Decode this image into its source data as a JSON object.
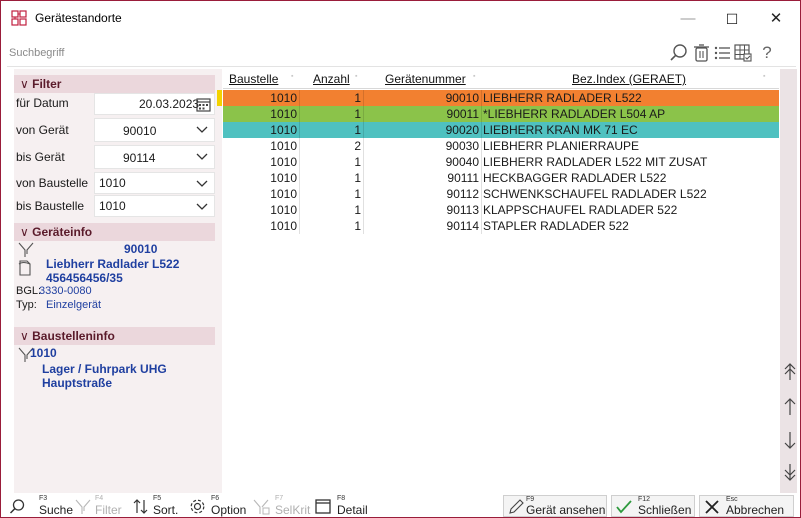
{
  "window": {
    "title": "Gerätestandorte",
    "controls": {
      "minimize": "—",
      "maximize": "☐",
      "close": "✕"
    }
  },
  "search": {
    "placeholder": "Suchbegriff",
    "icons": [
      "search-icon",
      "trash-icon",
      "list-icon",
      "grid-select-icon",
      "help-icon"
    ],
    "help_label": "?"
  },
  "filter": {
    "header": "Filter",
    "rows": [
      {
        "label": "für Datum",
        "value": "20.03.2023"
      },
      {
        "label": "von Gerät",
        "value": "90010"
      },
      {
        "label": "bis Gerät",
        "value": "90114"
      },
      {
        "label": "von Baustelle",
        "value": "1010"
      },
      {
        "label": "bis Baustelle",
        "value": "1010"
      }
    ]
  },
  "geraeteinfo": {
    "header": "Geräteinfo",
    "number": "90010",
    "name": "Liebherr Radlader L522",
    "serial": "456456456/35",
    "bgl_label": "BGL:",
    "bgl_value": "3330-0080",
    "typ_label": "Typ:",
    "typ_value": "Einzelgerät"
  },
  "baustelleninfo": {
    "header": "Baustelleninfo",
    "number": "1010",
    "name": "Lager / Fuhrpark UHG",
    "street": "Hauptstraße"
  },
  "grid": {
    "columns": [
      "Baustelle",
      "Anzahl",
      "Gerätenummer",
      "Bez.Index (GERAET)"
    ],
    "rows": [
      {
        "baustelle": "1010",
        "anzahl": "1",
        "nummer": "90010",
        "bez": "LIEBHERR RADLADER L522",
        "bg": "#f28030",
        "marker": true
      },
      {
        "baustelle": "1010",
        "anzahl": "1",
        "nummer": "90011",
        "bez": "*LIEBHERR RADLADER L504 AP",
        "bg": "#8bc34a",
        "marker": false
      },
      {
        "baustelle": "1010",
        "anzahl": "1",
        "nummer": "90020",
        "bez": "LIEBHERR KRAN MK 71 EC",
        "bg": "#4fc1c0",
        "marker": false
      },
      {
        "baustelle": "1010",
        "anzahl": "2",
        "nummer": "90030",
        "bez": "LIEBHERR PLANIERRAUPE",
        "bg": "",
        "marker": false
      },
      {
        "baustelle": "1010",
        "anzahl": "1",
        "nummer": "90040",
        "bez": "LIEBHERR RADLADER L522 MIT ZUSAT",
        "bg": "",
        "marker": false
      },
      {
        "baustelle": "1010",
        "anzahl": "1",
        "nummer": "90111",
        "bez": "HECKBAGGER RADLADER L522",
        "bg": "",
        "marker": false
      },
      {
        "baustelle": "1010",
        "anzahl": "1",
        "nummer": "90112",
        "bez": "SCHWENKSCHAUFEL RADLADER L522",
        "bg": "",
        "marker": false
      },
      {
        "baustelle": "1010",
        "anzahl": "1",
        "nummer": "90113",
        "bez": "KLAPPSCHAUFEL RADLADER 522",
        "bg": "",
        "marker": false
      },
      {
        "baustelle": "1010",
        "anzahl": "1",
        "nummer": "90114",
        "bez": "STAPLER RADLADER 522",
        "bg": "",
        "marker": false
      }
    ]
  },
  "scroll": {
    "icons": [
      "scroll-top-icon",
      "scroll-up-icon",
      "scroll-down-icon",
      "scroll-bottom-icon"
    ]
  },
  "footer": {
    "buttons": [
      {
        "key": "F3",
        "label": "Suche",
        "icon": "search-icon",
        "enabled": true
      },
      {
        "key": "F4",
        "label": "Filter",
        "icon": "filter-icon",
        "enabled": false
      },
      {
        "key": "F5",
        "label": "Sort.",
        "icon": "sort-icon",
        "enabled": true
      },
      {
        "key": "F6",
        "label": "Option",
        "icon": "gear-icon",
        "enabled": true
      },
      {
        "key": "F7",
        "label": "SelKrit",
        "icon": "selkrit-icon",
        "enabled": false
      },
      {
        "key": "F8",
        "label": "Detail",
        "icon": "detail-icon",
        "enabled": true
      }
    ],
    "actions": [
      {
        "key": "F9",
        "label": "Gerät ansehen",
        "icon": "pencil-icon"
      },
      {
        "key": "F12",
        "label": "Schließen",
        "icon": "check-icon"
      },
      {
        "key": "Esc",
        "label": "Abbrechen",
        "icon": "close-icon"
      }
    ]
  },
  "colors": {
    "accent": "#9a1d3a",
    "panel_bg": "#f6f0f1",
    "header_bg": "#ebd7dc",
    "info_blue": "#1f3fa0",
    "row_orange": "#f28030",
    "row_green": "#8bc34a",
    "row_teal": "#4fc1c0",
    "marker_yellow": "#f3d200"
  }
}
